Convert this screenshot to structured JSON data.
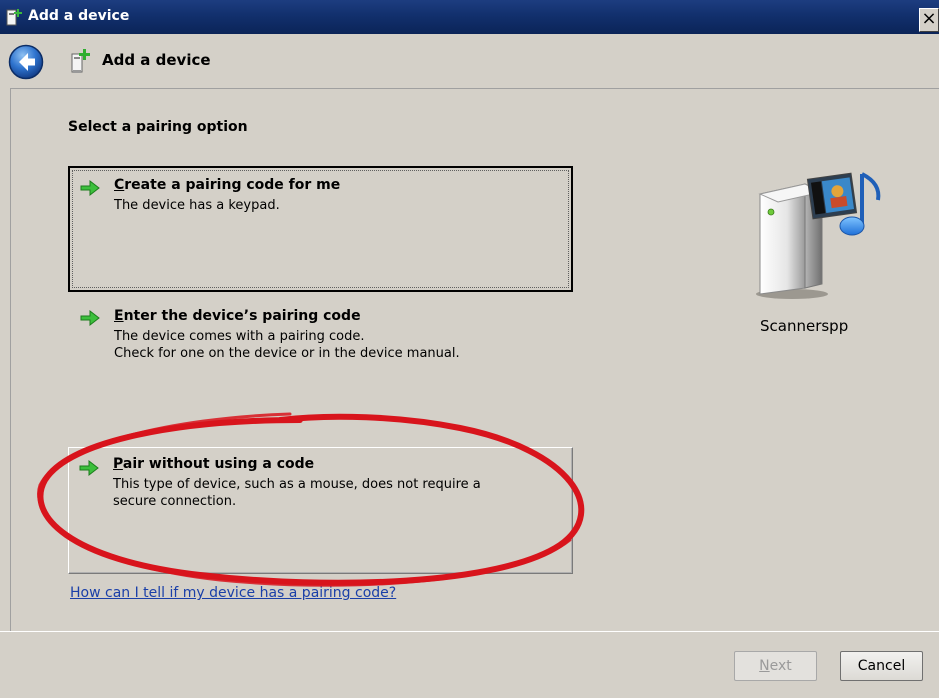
{
  "window": {
    "title": "Add a device",
    "close_glyph": "×"
  },
  "nav": {
    "back_icon": "back-arrow-icon",
    "title": "Add a device"
  },
  "main": {
    "heading": "Select a pairing option",
    "options": [
      {
        "title_mnemonic": "C",
        "title_rest": "reate a pairing code for me",
        "desc_lines": [
          "The device has a keypad."
        ],
        "icon": "green-arrow-icon"
      },
      {
        "title_mnemonic": "E",
        "title_rest": "nter the device’s pairing code",
        "desc_lines": [
          "The device comes with a pairing code.",
          "Check for one on the device or in the device manual."
        ],
        "icon": "green-arrow-icon"
      },
      {
        "title_mnemonic": "P",
        "title_rest": "air without using a code",
        "desc_lines": [
          "This type of device, such as a mouse, does not require a",
          "secure connection."
        ],
        "icon": "green-arrow-icon"
      }
    ],
    "help_link": "How can I tell if my device has a pairing code?"
  },
  "device": {
    "name": "Scannerspp",
    "icon": "media-device-icon"
  },
  "footer": {
    "next_mnemonic": "N",
    "next_rest": "ext",
    "cancel_label": "Cancel"
  },
  "colors": {
    "title_bar": "#12306d",
    "dialog_bg": "#d4d0c8",
    "link": "#1a3fa8",
    "annotation": "#d8141c"
  }
}
